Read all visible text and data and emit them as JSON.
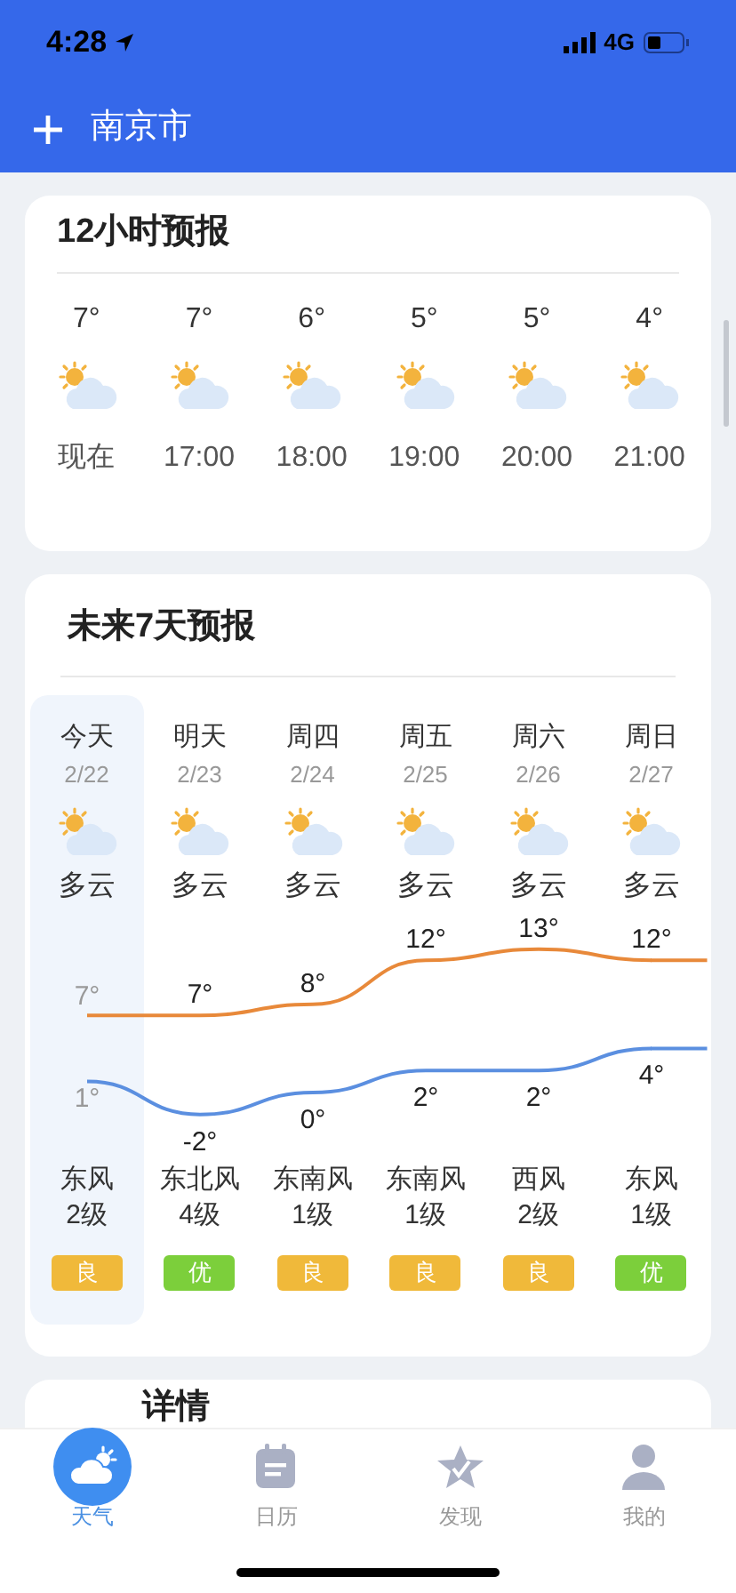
{
  "status_bar": {
    "time": "4:28",
    "network": "4G"
  },
  "header": {
    "city": "南京市"
  },
  "hourly": {
    "title": "12小时预报",
    "items": [
      {
        "temp": "7°",
        "time": "现在"
      },
      {
        "temp": "7°",
        "time": "17:00"
      },
      {
        "temp": "6°",
        "time": "18:00"
      },
      {
        "temp": "5°",
        "time": "19:00"
      },
      {
        "temp": "5°",
        "time": "20:00"
      },
      {
        "temp": "4°",
        "time": "21:00"
      }
    ]
  },
  "daily": {
    "title": "未来7天预报",
    "days": [
      {
        "day": "今天",
        "date": "2/22",
        "condition": "多云",
        "wind_dir": "东风",
        "wind_level": "2级",
        "aqi": "良",
        "color": "#f0b93a",
        "selected": true
      },
      {
        "day": "明天",
        "date": "2/23",
        "condition": "多云",
        "wind_dir": "东北风",
        "wind_level": "4级",
        "aqi": "优",
        "color": "#7ccf3b",
        "selected": false
      },
      {
        "day": "周四",
        "date": "2/24",
        "condition": "多云",
        "wind_dir": "东南风",
        "wind_level": "1级",
        "aqi": "良",
        "color": "#f0b93a",
        "selected": false
      },
      {
        "day": "周五",
        "date": "2/25",
        "condition": "多云",
        "wind_dir": "东南风",
        "wind_level": "1级",
        "aqi": "良",
        "color": "#f0b93a",
        "selected": false
      },
      {
        "day": "周六",
        "date": "2/26",
        "condition": "多云",
        "wind_dir": "西风",
        "wind_level": "2级",
        "aqi": "良",
        "color": "#f0b93a",
        "selected": false
      },
      {
        "day": "周日",
        "date": "2/27",
        "condition": "多云",
        "wind_dir": "东风",
        "wind_level": "1级",
        "aqi": "优",
        "color": "#7ccf3b",
        "selected": false
      }
    ],
    "chart_data": {
      "type": "line",
      "series": [
        {
          "color": "#e8893a",
          "values": [
            7,
            7,
            8,
            12,
            13,
            12
          ],
          "value_labels": [
            "7°",
            "7°",
            "8°",
            "12°",
            "13°",
            "12°"
          ]
        },
        {
          "color": "#5b8fe0",
          "values": [
            1,
            -2,
            0,
            2,
            2,
            4
          ],
          "value_labels": [
            "1°",
            "-2°",
            "0°",
            "2°",
            "2°",
            "4°"
          ]
        }
      ]
    }
  },
  "details": {
    "title": "详情"
  },
  "tabs": [
    {
      "label": "天气",
      "selected": true
    },
    {
      "label": "日历",
      "selected": false
    },
    {
      "label": "发现",
      "selected": false
    },
    {
      "label": "我的",
      "selected": false
    }
  ]
}
